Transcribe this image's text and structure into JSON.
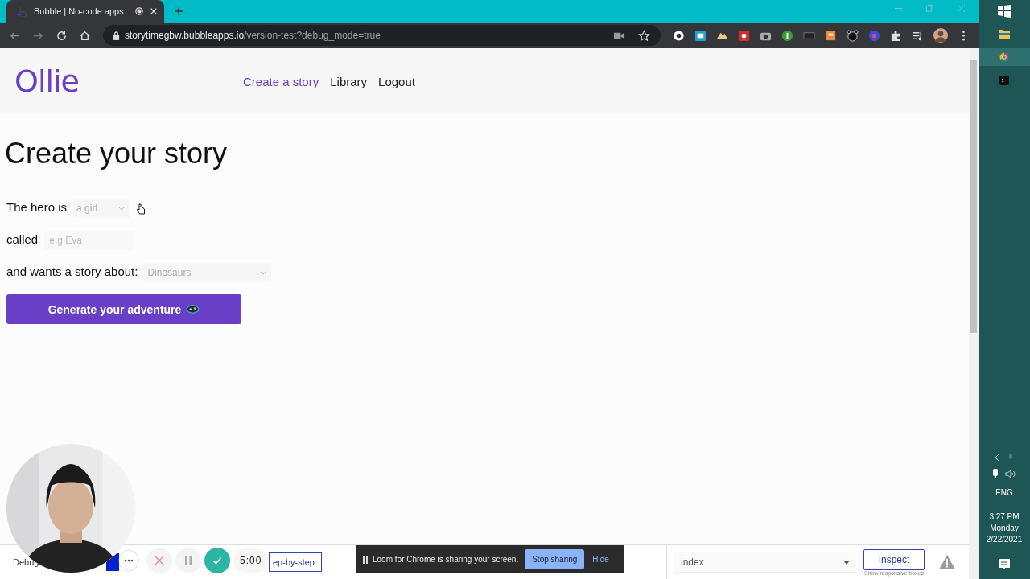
{
  "browser": {
    "tab_title": "Bubble | No-code apps",
    "url_host": "storytimegbw.bubbleapps.io",
    "url_path": "/version-test?debug_mode=true"
  },
  "header": {
    "logo": "Ollie",
    "nav": [
      {
        "label": "Create a story",
        "selected": true
      },
      {
        "label": "Library",
        "selected": false
      },
      {
        "label": "Logout",
        "selected": false
      }
    ]
  },
  "page": {
    "title": "Create your story",
    "fields": [
      {
        "kind": "dropdown",
        "label": "The hero is",
        "value": "a girl"
      },
      {
        "kind": "text",
        "label": "called",
        "placeholder": "e.g Eva"
      },
      {
        "kind": "dropdown",
        "label": "and wants a story about:",
        "value": "Dinosaurs"
      }
    ],
    "button": "Generate your adventure"
  },
  "debugger": {
    "label": "Debug",
    "step_button": "ep-by-step",
    "page_select": "index",
    "inspect_button": "Inspect",
    "inspect_hint": "Show responsive boxes"
  },
  "recorder": {
    "timer": "5:00"
  },
  "sharing_bar": {
    "message": "Loom for Chrome is sharing your screen.",
    "stop_button": "Stop sharing",
    "hide_button": "Hide"
  },
  "taskbar": {
    "language": "ENG",
    "time": "3:27 PM",
    "day": "Monday",
    "date": "2/22/2021"
  }
}
